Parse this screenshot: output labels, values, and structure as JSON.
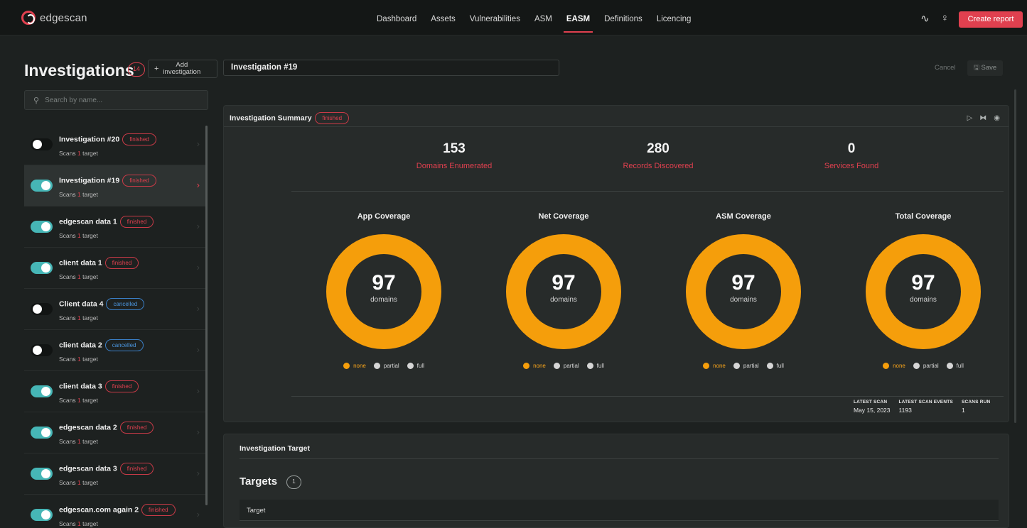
{
  "brand": {
    "name": "edgescan"
  },
  "nav": {
    "items": [
      {
        "label": "Dashboard",
        "active": false
      },
      {
        "label": "Assets",
        "active": false
      },
      {
        "label": "Vulnerabilities",
        "active": false
      },
      {
        "label": "ASM",
        "active": false
      },
      {
        "label": "EASM",
        "active": true
      },
      {
        "label": "Definitions",
        "active": false
      },
      {
        "label": "Licencing",
        "active": false
      }
    ],
    "create_report": "Create report"
  },
  "sidebar": {
    "title": "Investigations",
    "count": "14",
    "add_label_line1": "Add",
    "add_label_line2": "investigation",
    "search_placeholder": "Search by name...",
    "items": [
      {
        "name": "Investigation #20",
        "status": "finished",
        "sub_prefix": "Scans",
        "sub_count": "1",
        "sub_suffix": "target",
        "on": false,
        "selected": false
      },
      {
        "name": "Investigation #19",
        "status": "finished",
        "sub_prefix": "Scans",
        "sub_count": "1",
        "sub_suffix": "target",
        "on": true,
        "selected": true
      },
      {
        "name": "edgescan data 1",
        "status": "finished",
        "sub_prefix": "Scans",
        "sub_count": "1",
        "sub_suffix": "target",
        "on": true,
        "selected": false
      },
      {
        "name": "client data 1",
        "status": "finished",
        "sub_prefix": "Scans",
        "sub_count": "1",
        "sub_suffix": "target",
        "on": true,
        "selected": false
      },
      {
        "name": "Client data 4",
        "status": "cancelled",
        "sub_prefix": "Scans",
        "sub_count": "1",
        "sub_suffix": "target",
        "on": false,
        "selected": false
      },
      {
        "name": "client data 2",
        "status": "cancelled",
        "sub_prefix": "Scans",
        "sub_count": "1",
        "sub_suffix": "target",
        "on": false,
        "selected": false
      },
      {
        "name": "client data 3",
        "status": "finished",
        "sub_prefix": "Scans",
        "sub_count": "1",
        "sub_suffix": "target",
        "on": true,
        "selected": false
      },
      {
        "name": "edgescan data 2",
        "status": "finished",
        "sub_prefix": "Scans",
        "sub_count": "1",
        "sub_suffix": "target",
        "on": true,
        "selected": false
      },
      {
        "name": "edgescan data 3",
        "status": "finished",
        "sub_prefix": "Scans",
        "sub_count": "1",
        "sub_suffix": "target",
        "on": true,
        "selected": false
      },
      {
        "name": "edgescan.com again 2",
        "status": "finished",
        "sub_prefix": "Scans",
        "sub_count": "1",
        "sub_suffix": "target",
        "on": true,
        "selected": false
      }
    ]
  },
  "editor": {
    "title_value": "Investigation #19",
    "cancel": "Cancel",
    "save": "Save"
  },
  "summary": {
    "title": "Investigation Summary",
    "status": "finished",
    "stats": [
      {
        "value": "153",
        "label": "Domains Enumerated"
      },
      {
        "value": "280",
        "label": "Records Discovered"
      },
      {
        "value": "0",
        "label": "Services Found"
      }
    ],
    "coverage": [
      {
        "title": "App Coverage",
        "value": "97",
        "unit": "domains",
        "none_fraction": 1.0
      },
      {
        "title": "Net Coverage",
        "value": "97",
        "unit": "domains",
        "none_fraction": 1.0
      },
      {
        "title": "ASM Coverage",
        "value": "97",
        "unit": "domains",
        "none_fraction": 1.0
      },
      {
        "title": "Total Coverage",
        "value": "97",
        "unit": "domains",
        "none_fraction": 1.0
      }
    ],
    "legend": {
      "none": "none",
      "partial": "partial",
      "full": "full"
    },
    "colors": {
      "none": "#f59e0b",
      "partial": "#d6d6d6",
      "full": "#d6d6d6",
      "accent": "#e0404f"
    },
    "meta": {
      "latest_scan_label": "LATEST SCAN",
      "latest_scan_value": "May 15, 2023",
      "latest_events_label": "LATEST SCAN EVENTS",
      "latest_events_value": "1193",
      "scans_run_label": "SCANS RUN",
      "scans_run_value": "1"
    }
  },
  "target": {
    "card_title": "Investigation Target",
    "heading": "Targets",
    "count": "1",
    "column": "Target"
  }
}
